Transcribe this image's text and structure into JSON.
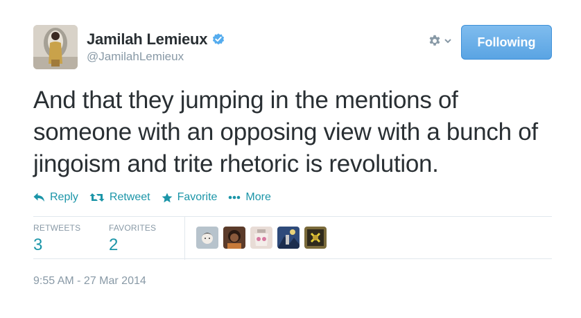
{
  "author": {
    "fullname": "Jamilah Lemieux",
    "username": "@JamilahLemieux",
    "verified": true
  },
  "follow_button": {
    "label": "Following"
  },
  "settings_icon": "gear-icon",
  "tweet": {
    "text": "And that they jumping in the mentions of someone with an opposing view with a bunch of jingoism and trite rhetoric is revolution."
  },
  "actions": {
    "reply": "Reply",
    "retweet": "Retweet",
    "favorite": "Favorite",
    "more": "More"
  },
  "stats": {
    "retweets_label": "RETWEETS",
    "retweets_value": "3",
    "favorites_label": "FAVORITES",
    "favorites_value": "2"
  },
  "timestamp": "9:55 AM - 27 Mar 2014",
  "colors": {
    "accent": "#1b95a8",
    "button": "#5aa4e3",
    "muted": "#8899a6",
    "text": "#292f33"
  }
}
